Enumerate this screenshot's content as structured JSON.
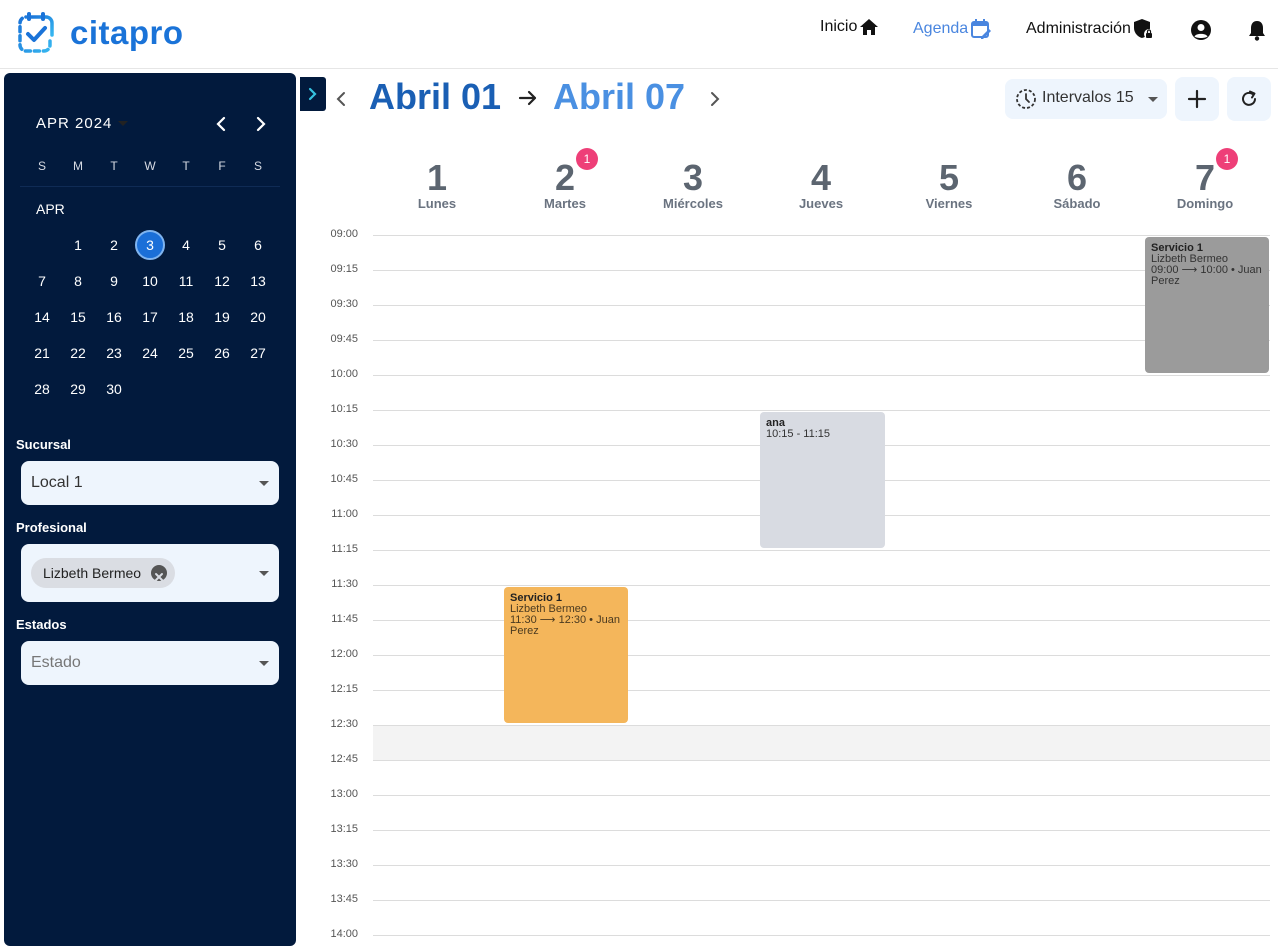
{
  "app": {
    "brand": "citapro"
  },
  "nav": {
    "inicio": "Inicio",
    "agenda": "Agenda",
    "admin": "Administración"
  },
  "calendar": {
    "header": "APR 2024",
    "month_label": "APR",
    "weekdays": [
      "S",
      "M",
      "T",
      "W",
      "T",
      "F",
      "S"
    ],
    "selected_day": 3,
    "days": [
      "1",
      "2",
      "3",
      "4",
      "5",
      "6",
      "7",
      "8",
      "9",
      "10",
      "11",
      "12",
      "13",
      "14",
      "15",
      "16",
      "17",
      "18",
      "19",
      "20",
      "21",
      "22",
      "23",
      "24",
      "25",
      "26",
      "27",
      "28",
      "29",
      "30"
    ]
  },
  "filters": {
    "sucursal_label": "Sucursal",
    "sucursal_value": "Local 1",
    "profesional_label": "Profesional",
    "profesional_chip": "Lizbeth Bermeo",
    "estados_label": "Estados",
    "estados_placeholder": "Estado"
  },
  "toolbar": {
    "range_start": "Abril 01",
    "range_end": "Abril 07",
    "interval_label": "Intervalos 15"
  },
  "week": [
    {
      "num": "1",
      "name": "Lunes",
      "badge": ""
    },
    {
      "num": "2",
      "name": "Martes",
      "badge": "1"
    },
    {
      "num": "3",
      "name": "Miércoles",
      "badge": ""
    },
    {
      "num": "4",
      "name": "Jueves",
      "badge": ""
    },
    {
      "num": "5",
      "name": "Viernes",
      "badge": ""
    },
    {
      "num": "6",
      "name": "Sábado",
      "badge": ""
    },
    {
      "num": "7",
      "name": "Domingo",
      "badge": "1"
    }
  ],
  "times": [
    "09:00",
    "09:15",
    "09:30",
    "09:45",
    "10:00",
    "10:15",
    "10:30",
    "10:45",
    "11:00",
    "11:15",
    "11:30",
    "11:45",
    "12:00",
    "12:15",
    "12:30",
    "12:45",
    "13:00",
    "13:15",
    "13:30",
    "13:45",
    "14:00"
  ],
  "events": [
    {
      "title": "Servicio 1",
      "professional": "Lizbeth Bermeo",
      "time": "11:30 ⟶ 12:30 • Juan Perez",
      "color": "#f4b65b"
    },
    {
      "title": "ana",
      "time": "10:15 - 11:15",
      "color": "#d8dbe2"
    },
    {
      "title": "Servicio 1",
      "professional": "Lizbeth Bermeo",
      "time": "09:00 ⟶ 10:00 • Juan Perez",
      "color": "#9b9b9b"
    }
  ],
  "colors": {
    "brand": "#1a73d8",
    "sidebar": "#021a3d",
    "badge": "#ee3f78",
    "selected": "#1b6fd8"
  }
}
